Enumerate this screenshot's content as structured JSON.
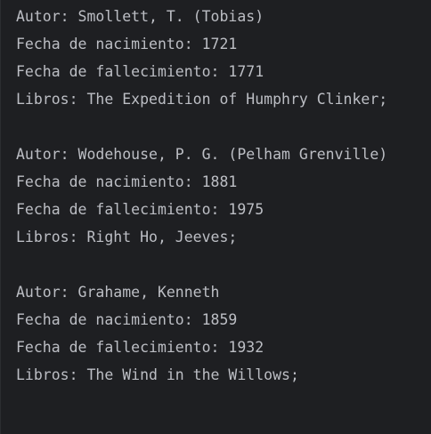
{
  "console": {
    "authors": [
      {
        "author_line": "Autor: Smollett, T. (Tobias)",
        "birth_line": "Fecha de nacimiento: 1721",
        "death_line": "Fecha de fallecimiento: 1771",
        "books_line": "Libros: The Expedition of Humphry Clinker;"
      },
      {
        "author_line": "Autor: Wodehouse, P. G. (Pelham Grenville)",
        "birth_line": "Fecha de nacimiento: 1881",
        "death_line": "Fecha de fallecimiento: 1975",
        "books_line": "Libros: Right Ho, Jeeves;"
      },
      {
        "author_line": "Autor: Grahame, Kenneth",
        "birth_line": "Fecha de nacimiento: 1859",
        "death_line": "Fecha de fallecimiento: 1932",
        "books_line": "Libros: The Wind in the Willows;"
      }
    ]
  }
}
